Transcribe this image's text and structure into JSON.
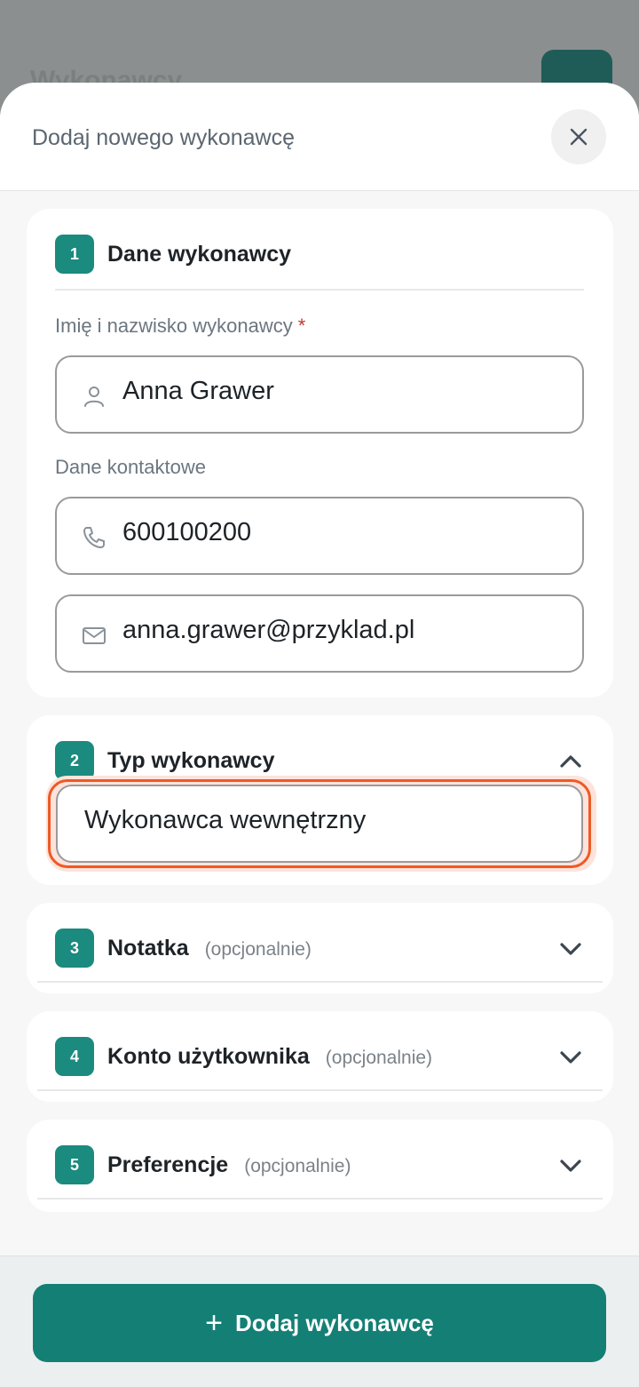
{
  "background": {
    "title": "Wykonawcy"
  },
  "dialog": {
    "title": "Dodaj nowego wykonawcę"
  },
  "sections": [
    {
      "number": "1",
      "title": "Dane wykonawcy"
    },
    {
      "number": "2",
      "title": "Typ wykonawcy"
    },
    {
      "number": "3",
      "title": "Notatka",
      "optional": "(opcjonalnie)"
    },
    {
      "number": "4",
      "title": "Konto użytkownika",
      "optional": "(opcjonalnie)"
    },
    {
      "number": "5",
      "title": "Preferencje",
      "optional": "(opcjonalnie)"
    }
  ],
  "form": {
    "name_label": "Imię i nazwisko wykonawcy",
    "required_mark": "*",
    "name_value": "Anna Grawer",
    "contact_label": "Dane kontaktowe",
    "phone_value": "600100200",
    "email_value": "anna.grawer@przyklad.pl",
    "type_value": "Wykonawca wewnętrzny"
  },
  "actions": {
    "submit_label": "Dodaj wykonawcę",
    "submit_icon": "+"
  },
  "colors": {
    "accent": "#1b8a7f",
    "focus": "#ee5a24",
    "button": "#147f75"
  }
}
